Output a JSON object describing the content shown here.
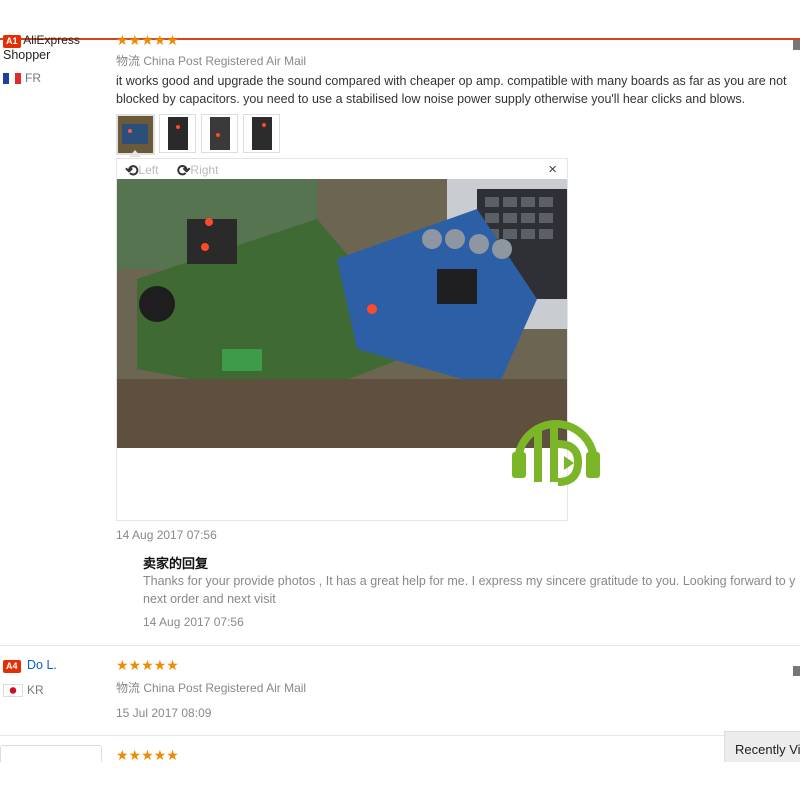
{
  "review1": {
    "user_badge": "A1",
    "user_name_line1": "AliExpress",
    "user_name_line2": "Shopper",
    "country": "FR",
    "stars": "★★★★★",
    "shipping": "物流 China Post Registered Air Mail",
    "text_line1": "it works good and upgrade the sound compared with cheaper op amp. compatible with many boards as far as you are not",
    "text_line2": "blocked by capacitors. you need to use a stabilised low noise power supply otherwise you'll hear clicks and blows.",
    "viewer": {
      "rotate_left": "Left",
      "rotate_right": "Right",
      "close": "×"
    },
    "date": "14 Aug 2017 07:56",
    "reply": {
      "title": "卖家的回复",
      "text_line1": "Thanks for your provide photos , It has a great help for me. I express my sincere gratitude to you. Looking forward to y",
      "text_line2": "next order and next visit",
      "date": "14 Aug 2017 07:56"
    }
  },
  "review2": {
    "user_badge": "A4",
    "user_name": "Do L.",
    "country": "KR",
    "stars": "★★★★★",
    "shipping": "物流 China Post Registered Air Mail",
    "date": "15 Jul 2017 08:09"
  },
  "review3": {
    "stars": "★★★★★"
  },
  "recently_viewed": "Recently Vi",
  "colors": {
    "accent": "#e62e04",
    "star": "#f08a00",
    "link": "#0066cc"
  }
}
